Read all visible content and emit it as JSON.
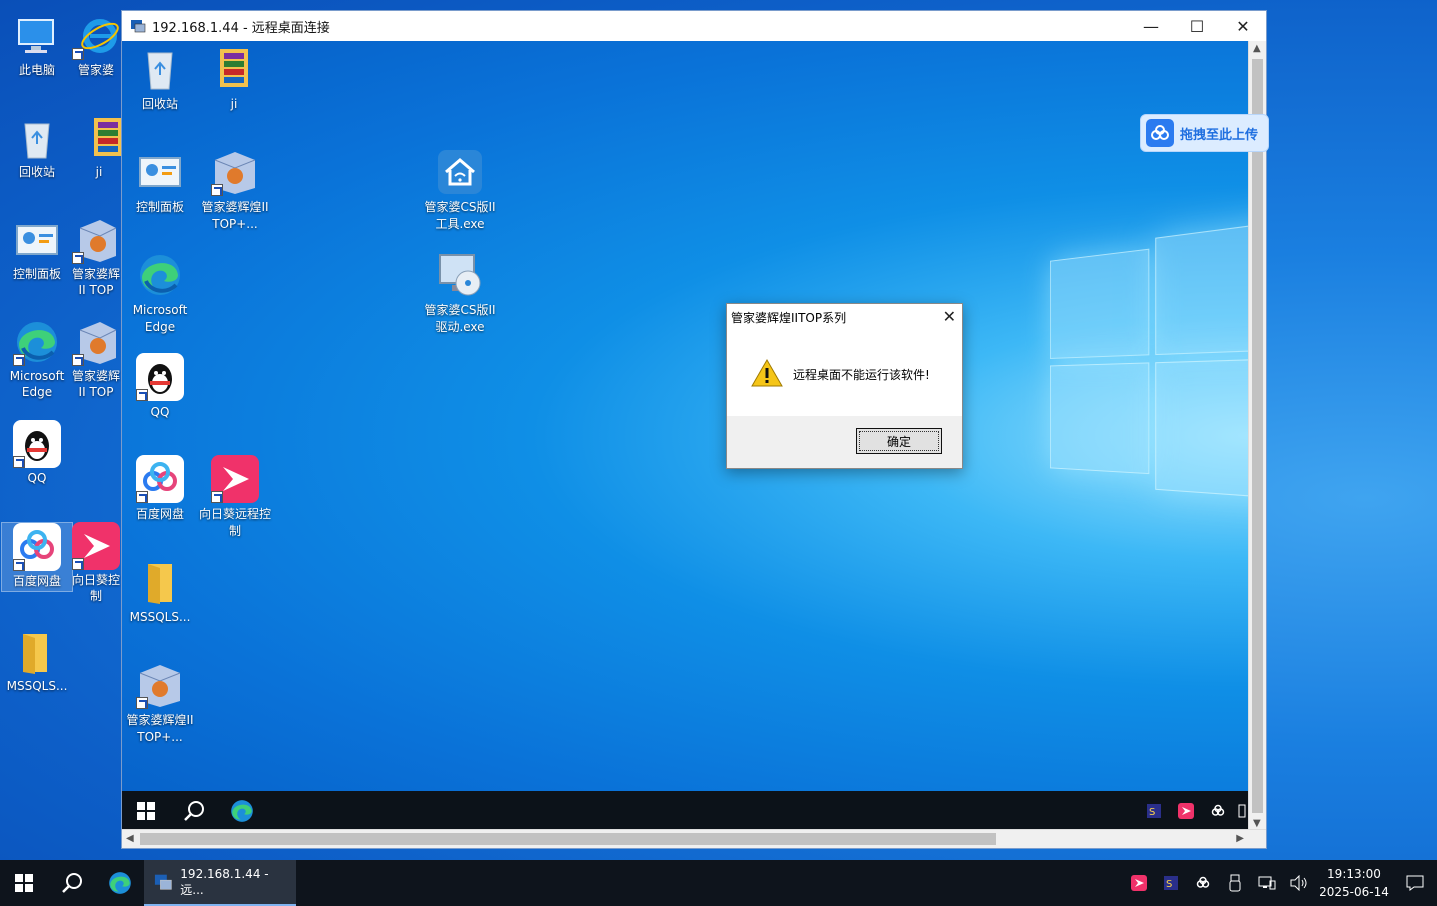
{
  "local_desktop": {
    "icons": [
      {
        "label": "此电脑"
      },
      {
        "label": "管家婆"
      },
      {
        "label": "回收站"
      },
      {
        "label": "ji"
      },
      {
        "label": "控制面板"
      },
      {
        "label": "管家婆辉II TOP"
      },
      {
        "label": "Microsoft Edge"
      },
      {
        "label": "管家婆辉II TOP"
      },
      {
        "label": "QQ"
      },
      {
        "label": "百度网盘"
      },
      {
        "label": "向日葵控制"
      },
      {
        "label": "MSSQLS..."
      }
    ]
  },
  "rdp": {
    "title": "192.168.1.44 - 远程桌面连接",
    "min": "—",
    "max": "☐",
    "close": "✕",
    "remote_icons": [
      {
        "label": "回收站"
      },
      {
        "label": "ji"
      },
      {
        "label": "控制面板"
      },
      {
        "label": "管家婆辉煌II TOP+..."
      },
      {
        "label": "管家婆CS版II工具.exe"
      },
      {
        "label": "Microsoft Edge"
      },
      {
        "label": "管家婆CS版II驱动.exe"
      },
      {
        "label": "QQ"
      },
      {
        "label": "百度网盘"
      },
      {
        "label": "向日葵远程控制"
      },
      {
        "label": "MSSQLS..."
      },
      {
        "label": "管家婆辉煌II TOP+..."
      }
    ]
  },
  "dialog": {
    "title": "管家婆辉煌IITOP系列",
    "close": "✕",
    "message": "远程桌面不能运行该软件!",
    "ok": "确定"
  },
  "upload": {
    "label": "拖拽至此上传"
  },
  "taskbar": {
    "app_label": "192.168.1.44 - 远...",
    "time": "19:13:00",
    "date": "2025-06-14"
  }
}
